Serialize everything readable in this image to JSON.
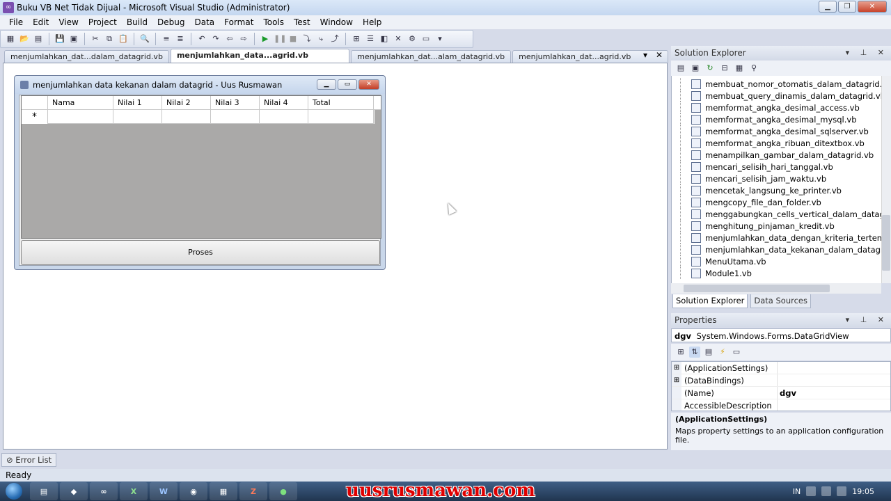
{
  "window": {
    "title": "Buku VB Net Tidak Dijual - Microsoft Visual Studio (Administrator)",
    "app_icon": "vs-icon"
  },
  "menu": [
    "File",
    "Edit",
    "View",
    "Project",
    "Build",
    "Debug",
    "Data",
    "Format",
    "Tools",
    "Test",
    "Window",
    "Help"
  ],
  "doc_tabs": [
    {
      "label": "menjumlahkan_dat...dalam_datagrid.vb",
      "active": false
    },
    {
      "label": "menjumlahkan_data...agrid.vb [Design]",
      "active": true
    },
    {
      "label": "menjumlahkan_dat...alam_datagrid.vb",
      "active": false
    },
    {
      "label": "menjumlahkan_dat...agrid.vb [Design]",
      "active": false
    }
  ],
  "form": {
    "title": "menjumlahkan data kekanan dalam datagrid - Uus Rusmawan",
    "grid_columns": [
      "Nama",
      "Nilai 1",
      "Nilai 2",
      "Nilai 3",
      "Nilai 4",
      "Total"
    ],
    "new_row_marker": "*",
    "button_label": "Proses"
  },
  "solution_explorer": {
    "title": "Solution Explorer",
    "files": [
      "membuat_nomor_otomatis_dalam_datagrid.vb",
      "membuat_query_dinamis_dalam_datagrid.vb",
      "memformat_angka_desimal_access.vb",
      "memformat_angka_desimal_mysql.vb",
      "memformat_angka_desimal_sqlserver.vb",
      "memformat_angka_ribuan_ditextbox.vb",
      "menampilkan_gambar_dalam_datagrid.vb",
      "mencari_selisih_hari_tanggal.vb",
      "mencari_selisih_jam_waktu.vb",
      "mencetak_langsung_ke_printer.vb",
      "mengcopy_file_dan_folder.vb",
      "menggabungkan_cells_vertical_dalam_datagrid.vb",
      "menghitung_pinjaman_kredit.vb",
      "menjumlahkan_data_dengan_kriteria_tertentu_dala",
      "menjumlahkan_data_kekanan_dalam_datagrid.vb",
      "MenuUtama.vb",
      "Module1.vb"
    ],
    "tabs": [
      "Solution Explorer",
      "Data Sources"
    ]
  },
  "properties": {
    "title": "Properties",
    "object_name": "dgv",
    "object_type": "System.Windows.Forms.DataGridView",
    "rows": [
      {
        "expander": "⊞",
        "name": "(ApplicationSettings)",
        "value": ""
      },
      {
        "expander": "⊞",
        "name": "(DataBindings)",
        "value": ""
      },
      {
        "expander": "",
        "name": "(Name)",
        "value": "dgv"
      },
      {
        "expander": "",
        "name": "AccessibleDescription",
        "value": ""
      }
    ],
    "description_title": "(ApplicationSettings)",
    "description_text": "Maps property settings to an application configuration file."
  },
  "error_list_label": "Error List",
  "status": "Ready",
  "taskbar": {
    "watermark": "uusrusmawan.com",
    "lang": "IN",
    "clock": "19:05"
  }
}
